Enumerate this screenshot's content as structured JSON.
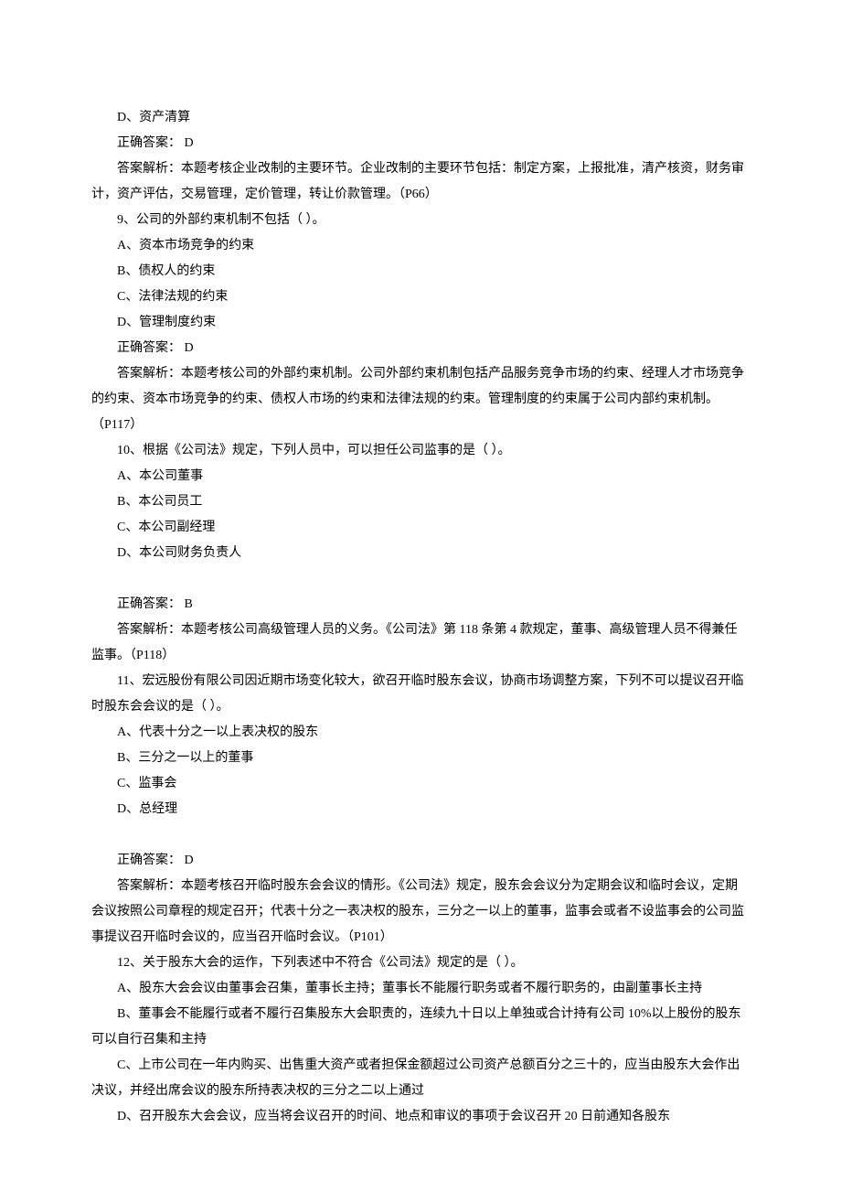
{
  "q8": {
    "opt_d": "D、资产清算",
    "answer": "正确答案：  D",
    "explain": "答案解析：本题考核企业改制的主要环节。企业改制的主要环节包括：制定方案，上报批准，清产核资，财务审计，资产评估，交易管理，定价管理，转让价款管理。（P66）"
  },
  "q9": {
    "stem": "9、公司的外部约束机制不包括（  ）。",
    "opt_a": "A、资本市场竞争的约束",
    "opt_b": "B、债权人的约束",
    "opt_c": "C、法律法规的约束",
    "opt_d": "D、管理制度约束",
    "answer": "正确答案：  D",
    "explain": "答案解析：本题考核公司的外部约束机制。公司外部约束机制包括产品服务竞争市场的约束、经理人才市场竞争的约束、资本市场竞争的约束、债权人市场的约束和法律法规的约束。管理制度的约束属于公司内部约束机制。（P117）"
  },
  "q10": {
    "stem": "10、根据《公司法》规定，下列人员中，可以担任公司监事的是（  ）。",
    "opt_a": "A、本公司董事",
    "opt_b": "B、本公司员工",
    "opt_c": "C、本公司副经理",
    "opt_d": "D、本公司财务负责人",
    "answer": "正确答案：  B",
    "explain": "答案解析：本题考核公司高级管理人员的义务。《公司法》第 118 条第 4 款规定，董事、高级管理人员不得兼任监事。（P118）"
  },
  "q11": {
    "stem": "11、宏远股份有限公司因近期市场变化较大，欲召开临时股东会议，协商市场调整方案，下列不可以提议召开临时股东会会议的是（  ）。",
    "opt_a": "A、代表十分之一以上表决权的股东",
    "opt_b": "B、三分之一以上的董事",
    "opt_c": "C、监事会",
    "opt_d": "D、总经理",
    "answer": "正确答案：  D",
    "explain": "答案解析：本题考核召开临时股东会会议的情形。《公司法》规定，股东会会议分为定期会议和临时会议，定期会议按照公司章程的规定召开；代表十分之一表决权的股东，三分之一以上的董事，监事会或者不设监事会的公司监事提议召开临时会议的，应当召开临时会议。（P101）"
  },
  "q12": {
    "stem": "12、关于股东大会的运作，下列表述中不符合《公司法》规定的是（  ）。",
    "opt_a": "A、股东大会会议由董事会召集，董事长主持；董事长不能履行职务或者不履行职务的，由副董事长主持",
    "opt_b": "B、董事会不能履行或者不履行召集股东大会职责的，连续九十日以上单独或合计持有公司 10%以上股份的股东可以自行召集和主持",
    "opt_c": "C、上市公司在一年内购买、出售重大资产或者担保金额超过公司资产总额百分之三十的，应当由股东大会作出决议，并经出席会议的股东所持表决权的三分之二以上通过",
    "opt_d": "D、召开股东大会会议，应当将会议召开的时间、地点和审议的事项于会议召开 20 日前通知各股东"
  }
}
